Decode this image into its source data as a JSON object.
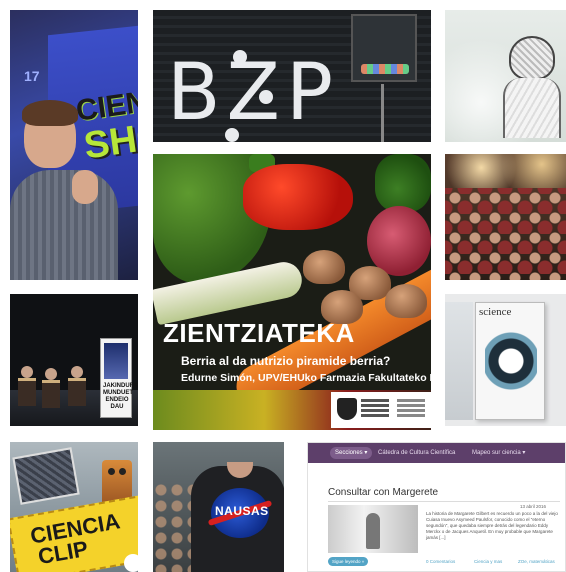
{
  "tiles": {
    "speaker": {
      "screen_number": "17",
      "screen_word_1": "CIEN",
      "screen_word_2": "SHO"
    },
    "bzp": {
      "sign_text": "BZP"
    },
    "zientziateka": {
      "title": "ZIENTZIATEKA",
      "subtitle": "Berria al da nutrizio piramide berria?",
      "speaker_line": "Edurne Simón, UPV/EHUko Farmazia Fakultateko Nutri"
    },
    "stage_banner": {
      "caption": "JAKINDURIEK MUNDUET ENDEIO DAU"
    },
    "journal": {
      "brand": "science"
    },
    "ciencia_clip": {
      "line1": "CIENCIA",
      "line2": "CLIP"
    },
    "nasa_shirt": {
      "logo_text": "NAUSAS"
    },
    "website": {
      "nav_pill": "Secciones ▾",
      "nav_link_1": "Cátedra de Cultura Científica",
      "nav_link_2": "Mapeo sur ciencia ▾",
      "article_title": "Consultar con Margerete",
      "date": "13 abril 2016",
      "excerpt": "La historia de Margarete Gilbert es recuerdo un poco a la del viejo Cuiasa Inuevo Asymeed Paulsfor, conocido como el \"eterno segundón\", que quedaba siempre detrás del legendario Eddy Merckx o de Jacques Anquetil. En muy probable que Margarete jamás [...]",
      "read_more": "Sigue leyendo »",
      "meta_1": "0 Comentarios",
      "meta_2": "Ciencia y mas",
      "meta_3": "ZOe, matemáticas"
    }
  }
}
